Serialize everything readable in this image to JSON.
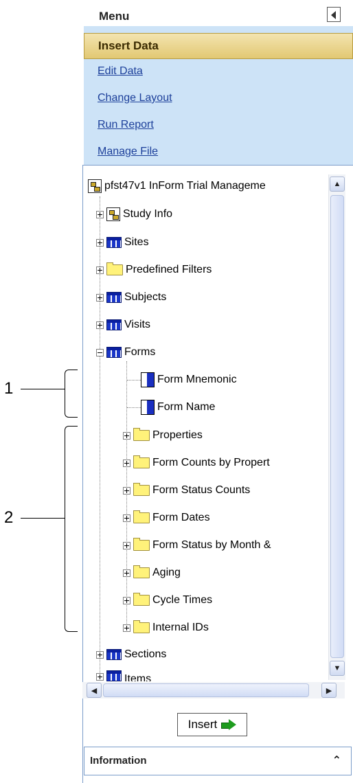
{
  "menu": {
    "title": "Menu",
    "items": [
      {
        "label": "Insert Data",
        "active": true
      },
      {
        "label": "Edit Data"
      },
      {
        "label": "Change Layout"
      },
      {
        "label": "Run Report"
      },
      {
        "label": "Manage File"
      }
    ]
  },
  "tree": {
    "root": "pfst47v1 InForm Trial Manageme",
    "nodes": [
      {
        "label": "Study Info",
        "icon": "study-icon"
      },
      {
        "label": "Sites",
        "icon": "table-icon"
      },
      {
        "label": "Predefined Filters",
        "icon": "folder-icon"
      },
      {
        "label": "Subjects",
        "icon": "table-icon"
      },
      {
        "label": "Visits",
        "icon": "table-icon"
      },
      {
        "label": "Forms",
        "icon": "table-icon",
        "expanded": true
      },
      {
        "label": "Form Mnemonic",
        "icon": "field-icon"
      },
      {
        "label": "Form Name",
        "icon": "field-icon"
      },
      {
        "label": "Properties",
        "icon": "folder-icon"
      },
      {
        "label": "Form Counts by Propert",
        "icon": "folder-icon"
      },
      {
        "label": "Form Status Counts",
        "icon": "folder-icon"
      },
      {
        "label": "Form Dates",
        "icon": "folder-icon"
      },
      {
        "label": "Form Status by Month &",
        "icon": "folder-icon"
      },
      {
        "label": "Aging",
        "icon": "folder-icon"
      },
      {
        "label": "Cycle Times",
        "icon": "folder-icon"
      },
      {
        "label": "Internal IDs",
        "icon": "folder-icon"
      },
      {
        "label": "Sections",
        "icon": "table-icon"
      },
      {
        "label": "Items",
        "icon": "table-icon"
      }
    ]
  },
  "insert_button": {
    "label": "Insert"
  },
  "information": {
    "title": "Information"
  },
  "callouts": {
    "one": "1",
    "two": "2"
  }
}
